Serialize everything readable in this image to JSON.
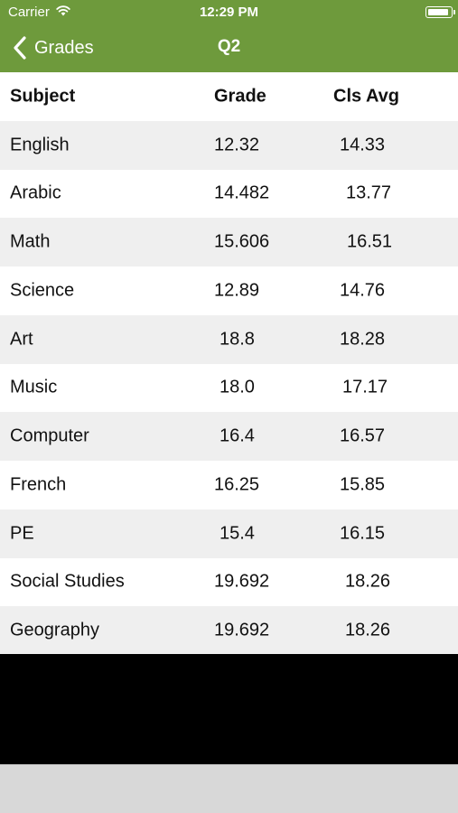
{
  "status_bar": {
    "carrier": "Carrier",
    "time": "12:29 PM",
    "battery_level": 0.95
  },
  "nav": {
    "back_label": "Grades",
    "title": "Q2"
  },
  "table": {
    "headers": {
      "subject": "Subject",
      "grade": "Grade",
      "avg": "Cls Avg"
    },
    "rows": [
      {
        "subject": "English",
        "grade": "12.32",
        "avg": "14.33"
      },
      {
        "subject": "Arabic",
        "grade": "14.482",
        "avg": "13.77"
      },
      {
        "subject": "Math",
        "grade": "15.606",
        "avg": "16.51"
      },
      {
        "subject": "Science",
        "grade": "12.89",
        "avg": "14.76"
      },
      {
        "subject": "Art",
        "grade": "18.8",
        "avg": "18.28"
      },
      {
        "subject": "Music",
        "grade": "18.0",
        "avg": "17.17"
      },
      {
        "subject": "Computer",
        "grade": "16.4",
        "avg": "16.57"
      },
      {
        "subject": "French",
        "grade": "16.25",
        "avg": "15.85"
      },
      {
        "subject": "PE",
        "grade": "15.4",
        "avg": "16.15"
      },
      {
        "subject": "Social Studies",
        "grade": "19.692",
        "avg": "18.26"
      },
      {
        "subject": "Geography",
        "grade": "19.692",
        "avg": "18.26"
      }
    ]
  },
  "colors": {
    "nav_bar": "#6e9a3c",
    "row_alt": "#efefef",
    "bottom_bar": "#d8d8d8"
  }
}
